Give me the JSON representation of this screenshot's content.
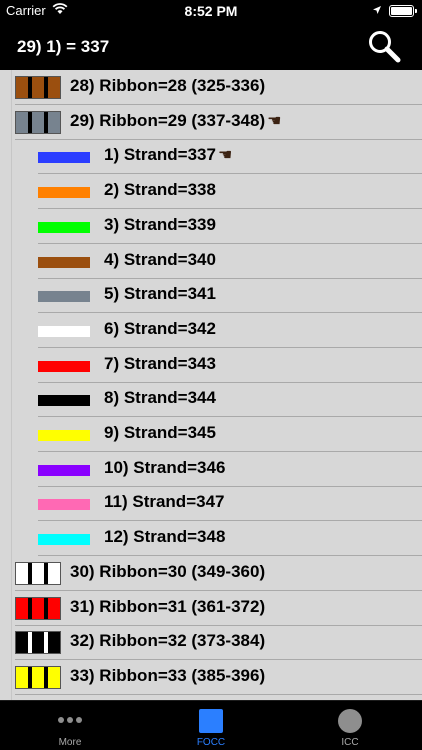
{
  "status": {
    "carrier": "Carrier",
    "time": "8:52 PM"
  },
  "nav": {
    "title": "29) 1) = 337"
  },
  "rows": [
    {
      "kind": "ribbon",
      "label": "28) Ribbon=28 (325-336)",
      "color": "#9b4f0f",
      "pointer": false
    },
    {
      "kind": "ribbon",
      "label": "29) Ribbon=29 (337-348)",
      "color": "#77838f",
      "pointer": true
    },
    {
      "kind": "strand",
      "label": "1) Strand=337",
      "color": "#2b3dff",
      "pointer": true
    },
    {
      "kind": "strand",
      "label": "2) Strand=338",
      "color": "#ff8000",
      "pointer": false
    },
    {
      "kind": "strand",
      "label": "3) Strand=339",
      "color": "#00ff00",
      "pointer": false
    },
    {
      "kind": "strand",
      "label": "4) Strand=340",
      "color": "#9b4f0f",
      "pointer": false
    },
    {
      "kind": "strand",
      "label": "5) Strand=341",
      "color": "#77838f",
      "pointer": false
    },
    {
      "kind": "strand",
      "label": "6) Strand=342",
      "color": "#ffffff",
      "pointer": false
    },
    {
      "kind": "strand",
      "label": "7) Strand=343",
      "color": "#ff0000",
      "pointer": false
    },
    {
      "kind": "strand",
      "label": "8) Strand=344",
      "color": "#000000",
      "pointer": false
    },
    {
      "kind": "strand",
      "label": "9) Strand=345",
      "color": "#ffff00",
      "pointer": false
    },
    {
      "kind": "strand",
      "label": "10) Strand=346",
      "color": "#8a00ff",
      "pointer": false
    },
    {
      "kind": "strand",
      "label": "11) Strand=347",
      "color": "#ff69b4",
      "pointer": false
    },
    {
      "kind": "strand",
      "label": "12) Strand=348",
      "color": "#00ffff",
      "pointer": false
    },
    {
      "kind": "ribbon",
      "label": "30) Ribbon=30 (349-360)",
      "color": "#ffffff",
      "pointer": false
    },
    {
      "kind": "ribbon",
      "label": "31) Ribbon=31 (361-372)",
      "color": "#ff0000",
      "pointer": false
    },
    {
      "kind": "ribbon",
      "label": "32) Ribbon=32 (373-384)",
      "color": "#000000",
      "pointer": false
    },
    {
      "kind": "ribbon",
      "label": "33) Ribbon=33 (385-396)",
      "color": "#ffff00",
      "pointer": false
    },
    {
      "kind": "ribbon",
      "label": "",
      "color": "#8a00ff",
      "pointer": false
    }
  ],
  "tabs": [
    {
      "label": "More",
      "icon": "more-icon",
      "active": false
    },
    {
      "label": "FOCC",
      "icon": "focc-square-icon",
      "active": true
    },
    {
      "label": "ICC",
      "icon": "icc-circle-icon",
      "active": false
    }
  ],
  "colors": {
    "accent": "#2b7fff",
    "list_bg": "#d7d7d7"
  }
}
